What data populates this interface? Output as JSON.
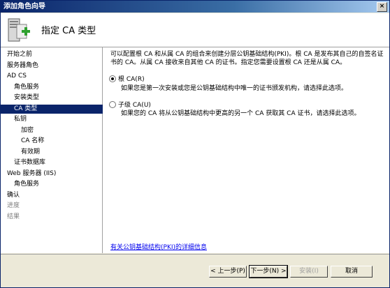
{
  "window": {
    "title": "添加角色向导",
    "close": "×"
  },
  "header": {
    "title": "指定 CA 类型"
  },
  "sidebar": {
    "items": [
      {
        "label": "开始之前",
        "level": 0,
        "state": "normal"
      },
      {
        "label": "服务器角色",
        "level": 0,
        "state": "normal"
      },
      {
        "label": "AD CS",
        "level": 0,
        "state": "normal"
      },
      {
        "label": "角色服务",
        "level": 1,
        "state": "normal"
      },
      {
        "label": "安装类型",
        "level": 1,
        "state": "normal"
      },
      {
        "label": "CA 类型",
        "level": 1,
        "state": "active"
      },
      {
        "label": "私钥",
        "level": 1,
        "state": "normal"
      },
      {
        "label": "加密",
        "level": 2,
        "state": "normal"
      },
      {
        "label": "CA 名称",
        "level": 2,
        "state": "normal"
      },
      {
        "label": "有效期",
        "level": 2,
        "state": "normal"
      },
      {
        "label": "证书数据库",
        "level": 1,
        "state": "normal"
      },
      {
        "label": "Web 服务器 (IIS)",
        "level": 0,
        "state": "normal"
      },
      {
        "label": "角色服务",
        "level": 1,
        "state": "normal"
      },
      {
        "label": "确认",
        "level": 0,
        "state": "normal"
      },
      {
        "label": "进度",
        "level": 0,
        "state": "disabled"
      },
      {
        "label": "结果",
        "level": 0,
        "state": "disabled"
      }
    ]
  },
  "main": {
    "intro": "可以配置根 CA 和从属 CA 的组合来创建分层公钥基础结构(PKI)。根 CA 是发布其自己的自签名证书的 CA。从属 CA 接收来自其他 CA 的证书。指定您需要设置根 CA 还是从属 CA。",
    "options": [
      {
        "label": "根 CA(R)",
        "description": "如果您是第一次安装或您是公钥基础结构中唯一的证书颁发机构，请选择此选项。",
        "checked": true
      },
      {
        "label": "子级 CA(U)",
        "description": "如果您的 CA 将从公钥基础结构中更高的另一个 CA 获取其 CA 证书，请选择此选项。",
        "checked": false
      }
    ],
    "more_link": "有关公钥基础结构(PKI)的详细信息"
  },
  "buttons": {
    "prev": "< 上一步(P)",
    "next": "下一步(N) >",
    "install": "安装(I)",
    "cancel": "取消"
  }
}
